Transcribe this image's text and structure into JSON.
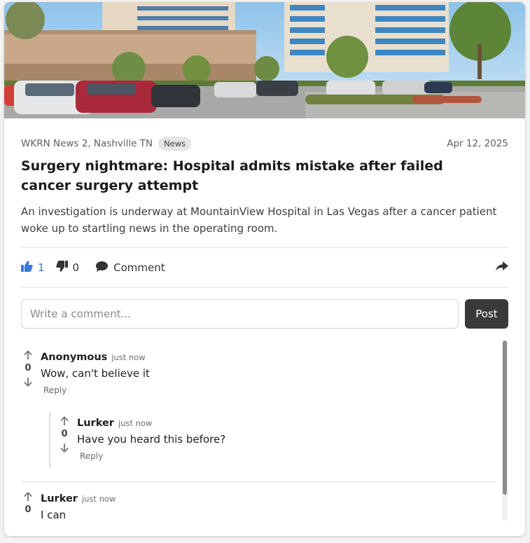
{
  "article": {
    "source": "WKRN News 2, Nashville TN",
    "tag": "News",
    "date": "Apr 12, 2025",
    "title": "Surgery nightmare: Hospital admits mistake after failed cancer surgery attempt",
    "summary": "An investigation is underway at MountainView Hospital in Las Vegas after a cancer patient woke up to startling news in the operating room."
  },
  "actions": {
    "likes": "1",
    "dislikes": "0",
    "comment_label": "Comment"
  },
  "comment_form": {
    "placeholder": "Write a comment...",
    "post_label": "Post"
  },
  "comments": [
    {
      "author": "Anonymous",
      "time": "just now",
      "score": "0",
      "text": "Wow, can't believe it",
      "reply_label": "Reply",
      "replies": [
        {
          "author": "Lurker",
          "time": "just now",
          "score": "0",
          "text": "Have you heard this before?",
          "reply_label": "Reply"
        }
      ]
    },
    {
      "author": "Lurker",
      "time": "just now",
      "score": "0",
      "text": "I can"
    }
  ],
  "colors": {
    "accent_like": "#3a78d8",
    "post_button": "#3a3a3a"
  },
  "icons": {
    "like": "thumbs-up-icon",
    "dislike": "thumbs-down-icon",
    "comment": "speech-bubble-icon",
    "share": "share-arrow-icon",
    "upvote": "arrow-up-icon",
    "downvote": "arrow-down-icon"
  }
}
